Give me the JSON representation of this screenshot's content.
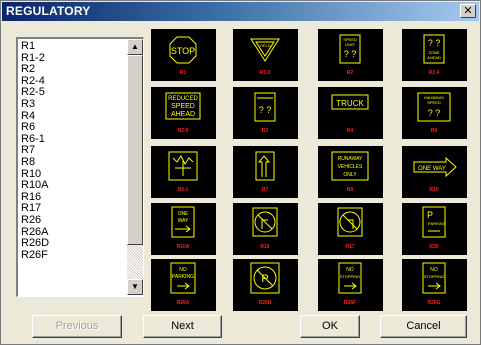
{
  "window": {
    "title": "REGULATORY",
    "close_glyph": "✕"
  },
  "list": {
    "items": [
      "R1",
      "R1-2",
      "R2",
      "R2-4",
      "R2-5",
      "R3",
      "R4",
      "R6",
      "R6-1",
      "R7",
      "R8",
      "R10",
      "R10A",
      "R16",
      "R17",
      "R26",
      "R26A",
      "R26D",
      "R26F"
    ],
    "scroll_up_glyph": "▲",
    "scroll_down_glyph": "▼"
  },
  "signs": [
    {
      "id": "stop",
      "text": [
        "STOP"
      ],
      "caption": "R1"
    },
    {
      "id": "yield",
      "text": [
        "YIELD"
      ],
      "caption": "R1-2"
    },
    {
      "id": "speed-limit",
      "text": [
        "SPEED",
        "LIMIT",
        "? ?"
      ],
      "caption": "R2"
    },
    {
      "id": "zone-ahead",
      "text": [
        "? ?",
        "ZONE",
        "AHEAD"
      ],
      "caption": "R2-4"
    },
    {
      "id": "reduced",
      "text": [
        "REDUCED",
        "SPEED",
        "AHEAD"
      ],
      "caption": "R2-5"
    },
    {
      "id": "speed-2",
      "text": [
        "? ?"
      ],
      "caption": "R3"
    },
    {
      "id": "truck",
      "text": [
        "TRUCK"
      ],
      "caption": "R4"
    },
    {
      "id": "max-speed",
      "text": [
        "MAXIMUM",
        "SPEED",
        "? ?"
      ],
      "caption": "R6"
    },
    {
      "id": "graphic",
      "text": [],
      "caption": "R6-1"
    },
    {
      "id": "arrow-up",
      "text": [],
      "caption": "R7"
    },
    {
      "id": "runaway",
      "text": [
        "RUNAWAY",
        "VEHICLES",
        "ONLY"
      ],
      "caption": "R8"
    },
    {
      "id": "one-way-arrow",
      "text": [
        "ONE WAY"
      ],
      "caption": "R10"
    },
    {
      "id": "one-way",
      "text": [
        "ONE",
        "WAY"
      ],
      "caption": "R10A"
    },
    {
      "id": "no-turn-1",
      "text": [],
      "caption": "R16"
    },
    {
      "id": "no-turn-2",
      "text": [],
      "caption": "R17"
    },
    {
      "id": "parking",
      "text": [
        "P",
        "PARKING"
      ],
      "caption": "R26"
    },
    {
      "id": "no-parking",
      "text": [
        "NO",
        "PARKING"
      ],
      "caption": "R26A"
    },
    {
      "id": "no-p",
      "text": [
        "P"
      ],
      "caption": "R26D"
    },
    {
      "id": "stopping",
      "text": [
        "NO",
        "STOPPING"
      ],
      "caption": "R26F"
    },
    {
      "id": "stopping-2",
      "text": [
        "NO",
        "STOPPING"
      ],
      "caption": "R26G"
    }
  ],
  "buttons": {
    "previous": "Previous",
    "next": "Next",
    "ok": "OK",
    "cancel": "Cancel"
  },
  "colors": {
    "sign_yellow": "#ffff00",
    "caption_red": "#ff2020",
    "tile_bg": "#000000",
    "title_blue": "#0a246a"
  }
}
